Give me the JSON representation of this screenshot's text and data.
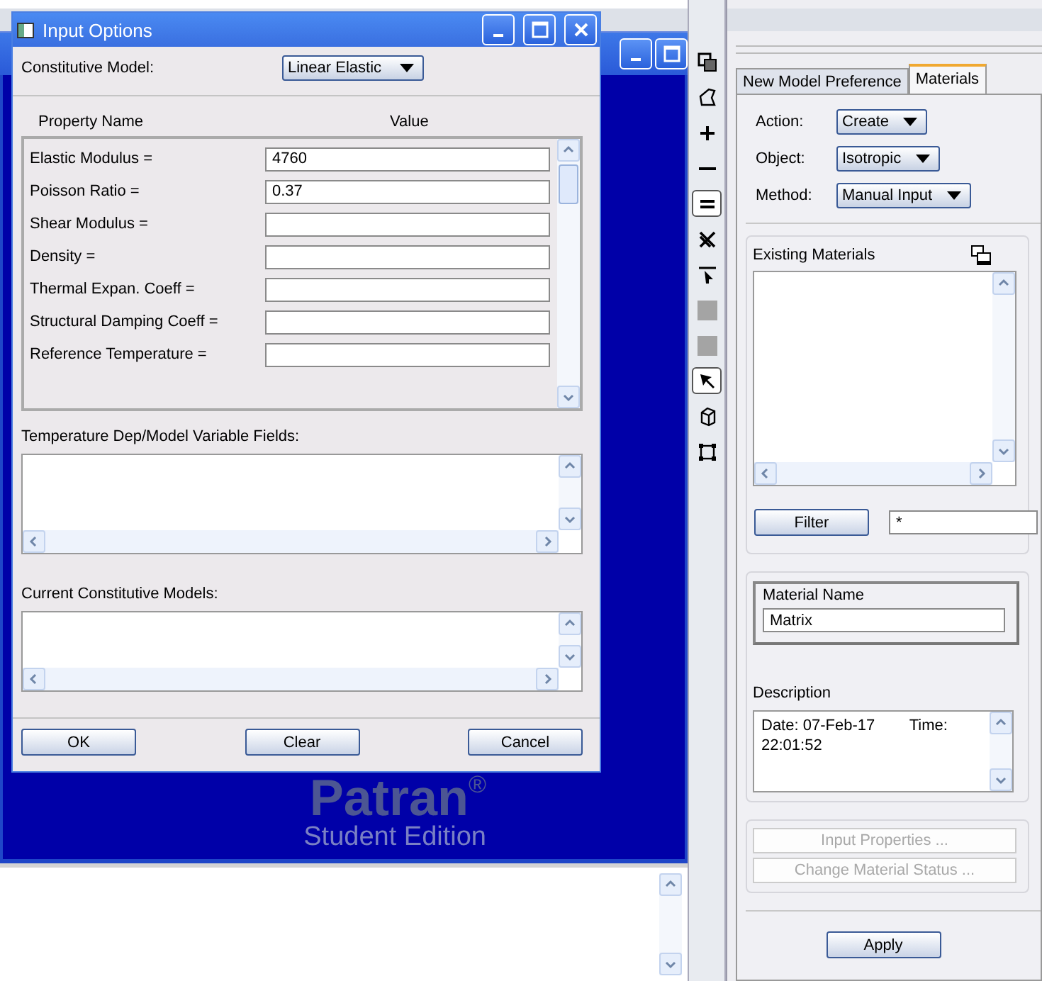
{
  "dialog": {
    "title": "Input Options",
    "model_label": "Constitutive Model:",
    "model_value": "Linear Elastic",
    "columns": [
      "Property Name",
      "Value"
    ],
    "properties": [
      {
        "label": "Elastic Modulus =",
        "value": "4760"
      },
      {
        "label": "Poisson Ratio =",
        "value": "0.37"
      },
      {
        "label": "Shear Modulus ="
      },
      {
        "label": "Density ="
      },
      {
        "label": "Thermal Expan. Coeff ="
      },
      {
        "label": "Structural Damping Coeff ="
      },
      {
        "label": "Reference Temperature ="
      }
    ],
    "variable_fields_label": "Temperature Dep/Model Variable Fields:",
    "current_models_label": "Current Constitutive Models:",
    "buttons": [
      "OK",
      "Clear",
      "Cancel"
    ]
  },
  "viewport": {
    "logo": "Patran$^{®}$",
    "edition": "Student Edition"
  },
  "toolbar": [
    {
      "kind": "windows",
      "selected": false
    },
    {
      "kind": "shape",
      "selected": false
    },
    {
      "kind": "plus",
      "selected": false
    },
    {
      "kind": "minus",
      "selected": false
    },
    {
      "kind": "equals",
      "selected": true
    },
    {
      "kind": "cross",
      "selected": false
    },
    {
      "kind": "pick",
      "selected": false
    },
    {
      "kind": "square",
      "selected": false
    },
    {
      "kind": "square",
      "selected": false
    },
    {
      "kind": "arrow",
      "selected": true
    },
    {
      "kind": "cube",
      "selected": false
    },
    {
      "kind": "frame",
      "selected": false
    }
  ],
  "panel": {
    "tabs": [
      {
        "label": "New Model Preference",
        "selected": false
      },
      {
        "label": "Materials",
        "selected": true
      }
    ],
    "selectors": [
      {
        "label": "Action:",
        "value": "Create"
      },
      {
        "label": "Object:",
        "value": "Isotropic"
      },
      {
        "label": "Method:",
        "value": "Manual Input"
      }
    ],
    "existing_label": "Existing Materials",
    "filter_button": "Filter",
    "filter_value": "*",
    "material_name_label": "Material Name",
    "material_name": "Matrix",
    "description_label": "Description",
    "description_lines": [
      "Date: 07-Feb-17        Time:",
      "22:01:52"
    ],
    "actions": [
      {
        "label": "Input Properties ...",
        "disabled": true
      },
      {
        "label": "Change Material Status ...",
        "disabled": true
      }
    ],
    "apply": "Apply"
  }
}
